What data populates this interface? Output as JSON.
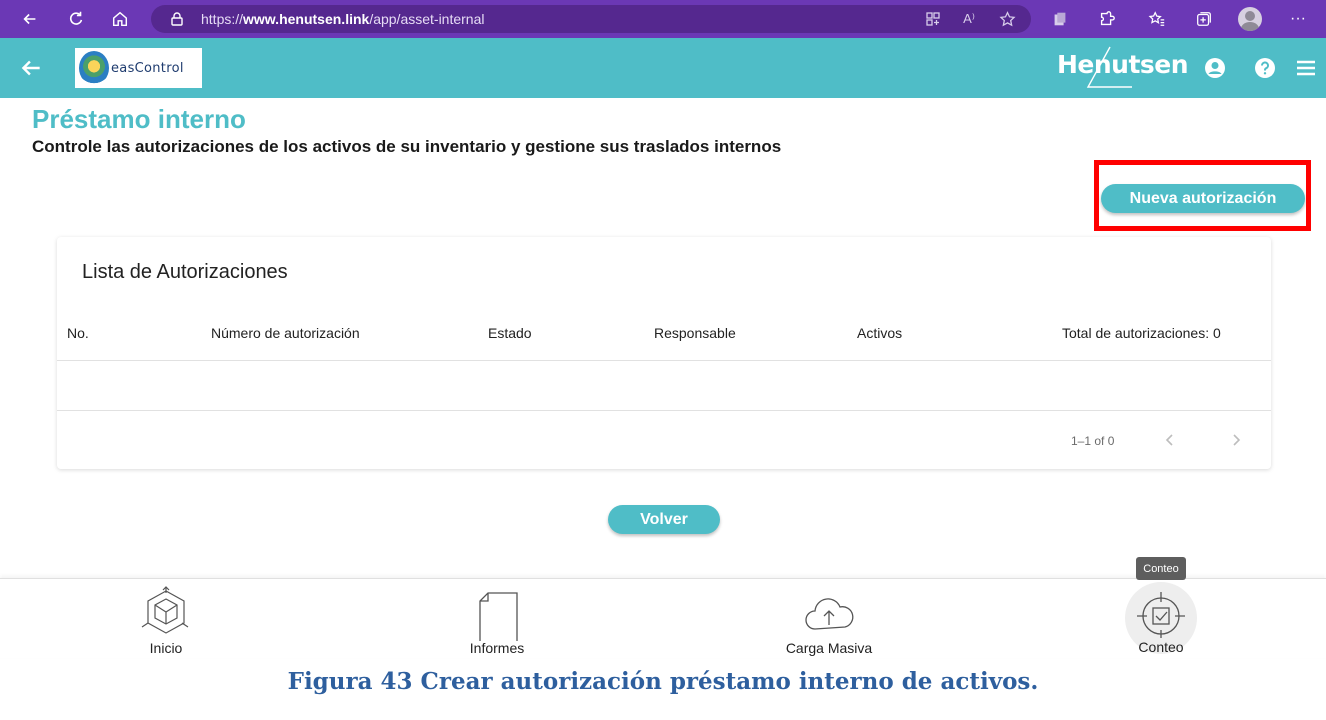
{
  "browser": {
    "url_prefix": "https://",
    "url_domain": "www.henutsen.link",
    "url_path": "/app/asset-internal",
    "read_aloud_glyph": "A⁾",
    "more_glyph": "···"
  },
  "header": {
    "logo_text": "easControl",
    "brand": "Henutsen"
  },
  "page": {
    "title": "Préstamo interno",
    "subtitle": "Controle las autorizaciones de los activos de su inventario y gestione sus traslados internos",
    "new_button": "Nueva autorización"
  },
  "list": {
    "title": "Lista de Autorizaciones",
    "columns": [
      "No.",
      "Número de autorización",
      "Estado",
      "Responsable",
      "Activos"
    ],
    "total_label": "Total de autorizaciones: 0",
    "pagination": "1–1 of 0"
  },
  "back_button": "Volver",
  "bottom_nav": {
    "items": [
      {
        "label": "Inicio",
        "icon": "cube-icon"
      },
      {
        "label": "Informes",
        "icon": "document-icon"
      },
      {
        "label": "Carga Masiva",
        "icon": "cloud-upload-icon"
      },
      {
        "label": "Conteo",
        "icon": "target-check-icon"
      }
    ],
    "tooltip": "Conteo",
    "active": "Conteo"
  },
  "caption": "Figura 43 Crear autorización préstamo interno de activos.",
  "colors": {
    "browser_bar": "#6b38b5",
    "accent": "#4fbdc7",
    "highlight": "#ff0000",
    "caption": "#2e5f9e"
  }
}
